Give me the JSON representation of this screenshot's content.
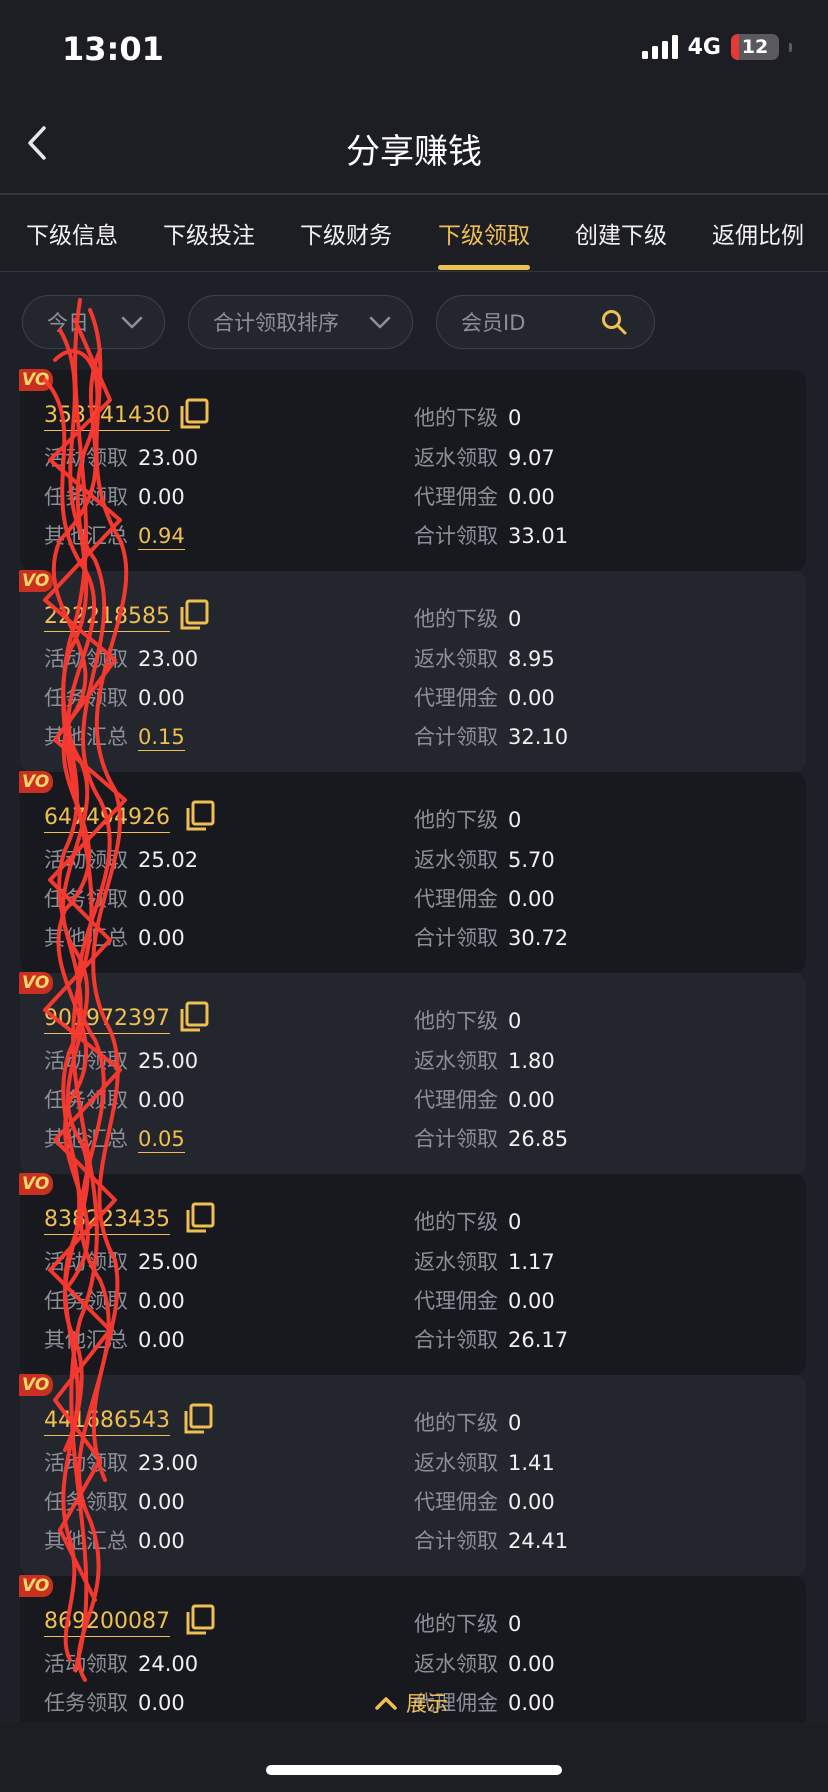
{
  "status": {
    "time": "13:01",
    "network": "4G",
    "battery": "12"
  },
  "header": {
    "title": "分享赚钱"
  },
  "tabs": [
    {
      "label": "下级信息",
      "active": false
    },
    {
      "label": "下级投注",
      "active": false
    },
    {
      "label": "下级财务",
      "active": false
    },
    {
      "label": "下级领取",
      "active": true
    },
    {
      "label": "创建下级",
      "active": false
    },
    {
      "label": "返佣比例",
      "active": false
    }
  ],
  "filters": {
    "period": "今日",
    "sort": "合计领取排序",
    "member_id_placeholder": "会员ID"
  },
  "labels": {
    "vip": "VO",
    "subordinates": "他的下级",
    "activity": "活动领取",
    "rebate": "返水领取",
    "task": "任务领取",
    "agent": "代理佣金",
    "other": "其他汇总",
    "total": "合计领取"
  },
  "members": [
    {
      "id": "353741430",
      "subordinates": "0",
      "activity": "23.00",
      "rebate": "9.07",
      "task": "0.00",
      "agent": "0.00",
      "other": "0.94",
      "other_link": true,
      "total": "33.01"
    },
    {
      "id": "222218585",
      "subordinates": "0",
      "activity": "23.00",
      "rebate": "8.95",
      "task": "0.00",
      "agent": "0.00",
      "other": "0.15",
      "other_link": true,
      "total": "32.10"
    },
    {
      "id": "647494926",
      "subordinates": "0",
      "activity": "25.02",
      "rebate": "5.70",
      "task": "0.00",
      "agent": "0.00",
      "other": "0.00",
      "other_link": false,
      "total": "30.72"
    },
    {
      "id": "901972397",
      "subordinates": "0",
      "activity": "25.00",
      "rebate": "1.80",
      "task": "0.00",
      "agent": "0.00",
      "other": "0.05",
      "other_link": true,
      "total": "26.85"
    },
    {
      "id": "838223435",
      "subordinates": "0",
      "activity": "25.00",
      "rebate": "1.17",
      "task": "0.00",
      "agent": "0.00",
      "other": "0.00",
      "other_link": false,
      "total": "26.17"
    },
    {
      "id": "441686543",
      "subordinates": "0",
      "activity": "23.00",
      "rebate": "1.41",
      "task": "0.00",
      "agent": "0.00",
      "other": "0.00",
      "other_link": false,
      "total": "24.41"
    },
    {
      "id": "869200087",
      "subordinates": "0",
      "activity": "24.00",
      "rebate": "0.00",
      "task": "0.00",
      "agent": "0.00",
      "other": "",
      "other_link": false,
      "total": ""
    }
  ],
  "footer": {
    "expand_label": "展示"
  },
  "colors": {
    "accent": "#f0bf52",
    "background": "#1e2028",
    "vip_badge": "#c9301f",
    "scribble": "#ff3b30"
  }
}
